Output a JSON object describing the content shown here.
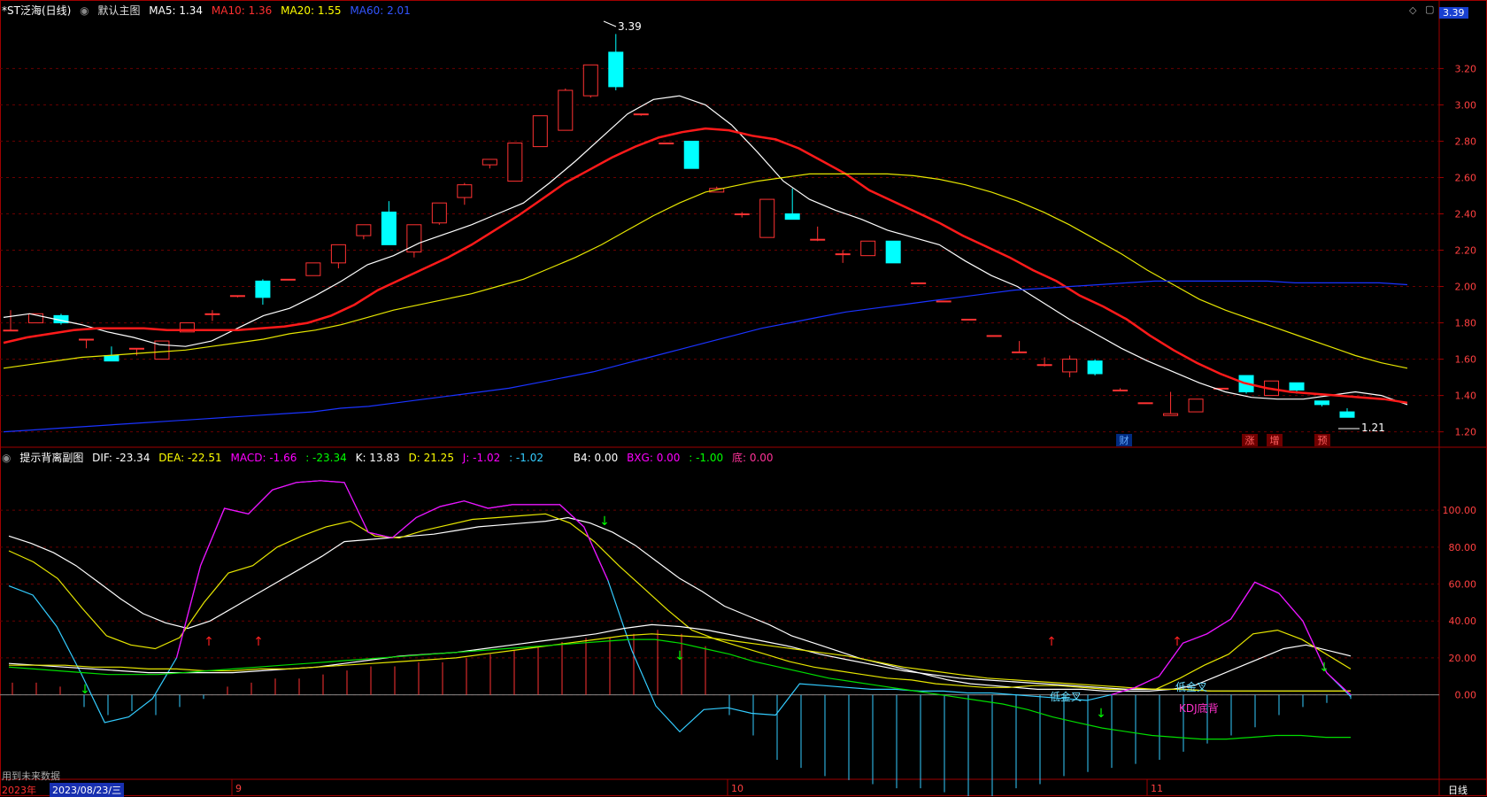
{
  "colors": {
    "bg": "#000000",
    "grid": "#6a0000",
    "frame": "#a00000",
    "up": "#ff3232",
    "down": "#00ffff",
    "white": "#ffffff",
    "red": "#ff2020",
    "yellow": "#ffff00",
    "blue": "#1a3aff",
    "magenta": "#ff00ff",
    "cyan": "#33ccff",
    "green": "#00ff00",
    "pink": "#ff3399"
  },
  "main_header": {
    "collapse_icon": "chevron-icon",
    "title": "*ST泛海(日线)",
    "chart_name": "默认主图",
    "ma5": "MA5: 1.34",
    "ma10": "MA10: 1.36",
    "ma20": "MA20: 1.55",
    "ma60": "MA60: 2.01"
  },
  "top_right": {
    "price_tag": "3.39",
    "icons": [
      "diamond-icon",
      "window-icon"
    ]
  },
  "sub_header": {
    "title": "提示背离副图",
    "dif": "DIF: -23.34",
    "dea": "DEA: -22.51",
    "macd": "MACD: -1.66",
    "extra1": ": -23.34",
    "k": "K: 13.83",
    "d": "D: 21.25",
    "j": "J: -1.02",
    "extra2": ": -1.02",
    "b4": "B4: 0.00",
    "bxg": "BXG: 0.00",
    "extra3": ": -1.00",
    "di": "底: 0.00"
  },
  "footer": {
    "note": "用到未来数据",
    "year": "2023年",
    "date": "2023/08/23/三",
    "period": "日线",
    "month_labels": [
      {
        "label": "9"
      },
      {
        "label": "10"
      },
      {
        "label": "11"
      }
    ]
  },
  "event_markers": [
    {
      "label": "财"
    },
    {
      "label": "涨"
    },
    {
      "label": "增"
    },
    {
      "label": "预"
    }
  ],
  "chart_data": [
    {
      "type": "candlestick",
      "title": "*ST泛海(日线)",
      "ylim": [
        1.13,
        3.47
      ],
      "yticks": [
        "3.20",
        "3.00",
        "2.80",
        "2.60",
        "2.40",
        "2.20",
        "2.00",
        "1.80",
        "1.60",
        "1.40",
        "1.20"
      ],
      "annotations": {
        "max": "3.39",
        "min": "1.21"
      },
      "candles": [
        [
          1.76,
          1.76,
          1.87,
          1.76
        ],
        [
          1.8,
          1.85,
          1.85,
          1.8
        ],
        [
          1.84,
          1.8,
          1.85,
          1.79
        ],
        [
          1.71,
          1.71,
          1.71,
          1.66
        ],
        [
          1.62,
          1.59,
          1.67,
          1.59
        ],
        [
          1.66,
          1.66,
          1.66,
          1.62
        ],
        [
          1.6,
          1.7,
          1.7,
          1.6
        ],
        [
          1.75,
          1.8,
          1.8,
          1.75
        ],
        [
          1.85,
          1.85,
          1.87,
          1.81
        ],
        [
          1.95,
          1.95,
          1.95,
          1.94
        ],
        [
          2.03,
          1.94,
          2.04,
          1.9
        ],
        [
          2.04,
          2.04,
          2.04,
          2.04
        ],
        [
          2.06,
          2.13,
          2.13,
          2.06
        ],
        [
          2.13,
          2.23,
          2.23,
          2.1
        ],
        [
          2.28,
          2.34,
          2.34,
          2.26
        ],
        [
          2.41,
          2.23,
          2.47,
          2.23
        ],
        [
          2.19,
          2.34,
          2.34,
          2.16
        ],
        [
          2.35,
          2.46,
          2.46,
          2.34
        ],
        [
          2.49,
          2.56,
          2.57,
          2.45
        ],
        [
          2.67,
          2.7,
          2.7,
          2.65
        ],
        [
          2.58,
          2.79,
          2.79,
          2.58
        ],
        [
          2.77,
          2.94,
          2.94,
          2.77
        ],
        [
          2.86,
          3.08,
          3.09,
          2.86
        ],
        [
          3.05,
          3.22,
          3.22,
          3.04
        ],
        [
          3.29,
          3.1,
          3.39,
          3.08
        ],
        [
          2.95,
          2.95,
          2.95,
          2.94
        ],
        [
          2.79,
          2.79,
          2.79,
          2.79
        ],
        [
          2.8,
          2.65,
          2.8,
          2.65
        ],
        [
          2.52,
          2.54,
          2.55,
          2.52
        ],
        [
          2.4,
          2.4,
          2.41,
          2.38
        ],
        [
          2.27,
          2.48,
          2.48,
          2.27
        ],
        [
          2.4,
          2.37,
          2.54,
          2.37
        ],
        [
          2.26,
          2.26,
          2.33,
          2.25
        ],
        [
          2.18,
          2.18,
          2.2,
          2.13
        ],
        [
          2.17,
          2.25,
          2.25,
          2.17
        ],
        [
          2.25,
          2.13,
          2.25,
          2.13
        ],
        [
          2.02,
          2.02,
          2.02,
          2.02
        ],
        [
          1.92,
          1.92,
          1.92,
          1.92
        ],
        [
          1.82,
          1.82,
          1.82,
          1.82
        ],
        [
          1.73,
          1.73,
          1.73,
          1.73
        ],
        [
          1.64,
          1.64,
          1.7,
          1.64
        ],
        [
          1.57,
          1.57,
          1.61,
          1.56
        ],
        [
          1.53,
          1.6,
          1.62,
          1.5
        ],
        [
          1.59,
          1.52,
          1.6,
          1.51
        ],
        [
          1.43,
          1.43,
          1.44,
          1.43
        ],
        [
          1.36,
          1.36,
          1.36,
          1.36
        ],
        [
          1.29,
          1.3,
          1.42,
          1.29
        ],
        [
          1.31,
          1.38,
          1.38,
          1.31
        ],
        [
          1.44,
          1.44,
          1.44,
          1.43
        ],
        [
          1.51,
          1.42,
          1.51,
          1.41
        ],
        [
          1.4,
          1.48,
          1.48,
          1.4
        ],
        [
          1.47,
          1.43,
          1.47,
          1.41
        ],
        [
          1.37,
          1.35,
          1.37,
          1.34
        ],
        [
          1.31,
          1.28,
          1.33,
          1.28
        ]
      ],
      "series": [
        {
          "name": "MA5",
          "values": [
            1.83,
            1.85,
            1.82,
            1.79,
            1.75,
            1.72,
            1.68,
            1.67,
            1.7,
            1.77,
            1.84,
            1.88,
            1.95,
            2.03,
            2.12,
            2.17,
            2.24,
            2.29,
            2.34,
            2.4,
            2.46,
            2.57,
            2.69,
            2.82,
            2.95,
            3.03,
            3.05,
            3.0,
            2.89,
            2.74,
            2.58,
            2.48,
            2.42,
            2.37,
            2.31,
            2.27,
            2.23,
            2.14,
            2.06,
            2.0,
            1.91,
            1.82,
            1.74,
            1.66,
            1.59,
            1.53,
            1.47,
            1.42,
            1.39,
            1.38,
            1.38,
            1.4,
            1.42,
            1.4,
            1.35
          ]
        },
        {
          "name": "MA10",
          "values": [
            1.69,
            1.72,
            1.74,
            1.76,
            1.77,
            1.77,
            1.77,
            1.76,
            1.76,
            1.76,
            1.76,
            1.77,
            1.78,
            1.8,
            1.84,
            1.9,
            1.98,
            2.04,
            2.1,
            2.16,
            2.23,
            2.31,
            2.39,
            2.48,
            2.57,
            2.64,
            2.71,
            2.77,
            2.82,
            2.85,
            2.87,
            2.86,
            2.83,
            2.81,
            2.76,
            2.69,
            2.62,
            2.53,
            2.47,
            2.41,
            2.35,
            2.28,
            2.22,
            2.16,
            2.09,
            2.03,
            1.95,
            1.89,
            1.82,
            1.73,
            1.65,
            1.58,
            1.52,
            1.47,
            1.44,
            1.42,
            1.41,
            1.4,
            1.39,
            1.38,
            1.36
          ]
        },
        {
          "name": "MA20",
          "values": [
            1.55,
            1.57,
            1.59,
            1.61,
            1.62,
            1.63,
            1.64,
            1.65,
            1.67,
            1.69,
            1.71,
            1.74,
            1.76,
            1.79,
            1.83,
            1.87,
            1.9,
            1.93,
            1.96,
            2.0,
            2.04,
            2.1,
            2.16,
            2.23,
            2.31,
            2.39,
            2.46,
            2.52,
            2.55,
            2.58,
            2.6,
            2.62,
            2.62,
            2.62,
            2.62,
            2.61,
            2.59,
            2.56,
            2.52,
            2.47,
            2.41,
            2.34,
            2.26,
            2.18,
            2.09,
            2.01,
            1.93,
            1.87,
            1.82,
            1.77,
            1.72,
            1.67,
            1.62,
            1.58,
            1.55
          ]
        },
        {
          "name": "MA60",
          "values": [
            1.2,
            1.21,
            1.22,
            1.23,
            1.24,
            1.25,
            1.26,
            1.27,
            1.28,
            1.29,
            1.3,
            1.31,
            1.33,
            1.34,
            1.36,
            1.38,
            1.4,
            1.42,
            1.44,
            1.47,
            1.5,
            1.53,
            1.57,
            1.61,
            1.65,
            1.69,
            1.73,
            1.77,
            1.8,
            1.83,
            1.86,
            1.88,
            1.9,
            1.92,
            1.94,
            1.96,
            1.98,
            1.99,
            2.0,
            2.01,
            2.02,
            2.03,
            2.03,
            2.03,
            2.03,
            2.03,
            2.02,
            2.02,
            2.02,
            2.02,
            2.01
          ]
        }
      ]
    },
    {
      "type": "line",
      "title": "提示背离副图",
      "ylim": [
        -40,
        125
      ],
      "yticks": [
        "100.00",
        "80.00",
        "60.00",
        "40.00",
        "20.00",
        "0.00"
      ],
      "series": [
        {
          "name": "K",
          "values": [
            86,
            82,
            77,
            70,
            61,
            52,
            44,
            39,
            36,
            40,
            47,
            54,
            61,
            68,
            75,
            83,
            84,
            85,
            86,
            87,
            89,
            91,
            92,
            93,
            94,
            96,
            93,
            88,
            81,
            72,
            63,
            56,
            48,
            43,
            38,
            32,
            28,
            24,
            20,
            17,
            14,
            11,
            8,
            6,
            5,
            4,
            3,
            3,
            3,
            2,
            2,
            2,
            3,
            5,
            10,
            15,
            20,
            25,
            27,
            24,
            21
          ]
        },
        {
          "name": "D",
          "values": [
            78,
            72,
            63,
            47,
            32,
            27,
            25,
            31,
            50,
            66,
            70,
            80,
            86,
            91,
            94,
            86,
            85,
            89,
            92,
            95,
            96,
            97,
            98,
            93,
            83,
            70,
            58,
            46,
            35,
            30,
            26,
            22,
            18,
            15,
            13,
            11,
            9,
            8,
            6,
            5,
            4,
            4,
            5,
            5,
            4,
            3,
            3,
            3,
            9,
            16,
            22,
            33,
            35,
            30,
            22,
            14
          ]
        },
        {
          "name": "J",
          "values": [
            59,
            54,
            37,
            12,
            -15,
            -12,
            -2,
            20,
            70,
            101,
            98,
            111,
            115,
            116,
            115,
            88,
            85,
            96,
            102,
            105,
            101,
            103,
            103,
            103,
            91,
            62,
            24,
            -6,
            -20,
            -8,
            -7,
            -10,
            -11,
            6,
            5,
            4,
            3,
            3,
            2,
            2,
            1,
            1,
            0,
            -1,
            -2,
            -3,
            0,
            4,
            10,
            28,
            33,
            41,
            61,
            55,
            40,
            12,
            -1
          ]
        },
        {
          "name": "MACD-white",
          "values": [
            17,
            16,
            15,
            14,
            13,
            12,
            12,
            12,
            12,
            13,
            14,
            15,
            17,
            19,
            21,
            22,
            23,
            25,
            27,
            29,
            31,
            33,
            36,
            38,
            37,
            35,
            32,
            29,
            26,
            22,
            19,
            16,
            13,
            11,
            9,
            8,
            7,
            6,
            5,
            4,
            3,
            3,
            3,
            2,
            2,
            2,
            2,
            2,
            2
          ]
        },
        {
          "name": "MACD-yellow",
          "values": [
            16,
            16,
            16,
            15,
            15,
            14,
            14,
            13,
            13,
            14,
            14,
            15,
            16,
            17,
            18,
            19,
            20,
            22,
            24,
            26,
            28,
            30,
            32,
            33,
            32,
            31,
            29,
            27,
            25,
            23,
            21,
            18,
            15,
            13,
            11,
            9,
            8,
            7,
            6,
            5,
            4,
            3,
            3,
            2,
            2,
            2,
            2,
            2,
            2
          ]
        },
        {
          "name": "green",
          "values": [
            15,
            14,
            13,
            12,
            11,
            11,
            11,
            12,
            13,
            14,
            15,
            16,
            17,
            18,
            19,
            20,
            21,
            22,
            23,
            24,
            25,
            26,
            27,
            28,
            29,
            30,
            30,
            28,
            25,
            22,
            18,
            15,
            12,
            9,
            7,
            5,
            3,
            1,
            -1,
            -3,
            -5,
            -8,
            -12,
            -15,
            -18,
            -20,
            -22,
            -23,
            -24,
            -24,
            -23,
            -22,
            -22,
            -23,
            -23
          ]
        },
        {
          "name": "histogram",
          "values": [
            3,
            3,
            2,
            -3,
            -5,
            -4,
            -5,
            -3,
            -1,
            2,
            3,
            4,
            4,
            5,
            6,
            7,
            7,
            8,
            8,
            9,
            10,
            11,
            12,
            13,
            14,
            14,
            15,
            16,
            15,
            12,
            -5,
            -10,
            -16,
            -18,
            -20,
            -21,
            -22,
            -23,
            -23,
            -24,
            -25,
            -25,
            -23,
            -22,
            -20,
            -19,
            -18,
            -17,
            -16,
            -14,
            -12,
            -10,
            -8,
            -5,
            -3,
            -2,
            -1
          ]
        }
      ],
      "annotations": [
        {
          "label": "低金叉"
        },
        {
          "label": "低金叉"
        },
        {
          "label": "KDJ底背"
        }
      ]
    }
  ]
}
